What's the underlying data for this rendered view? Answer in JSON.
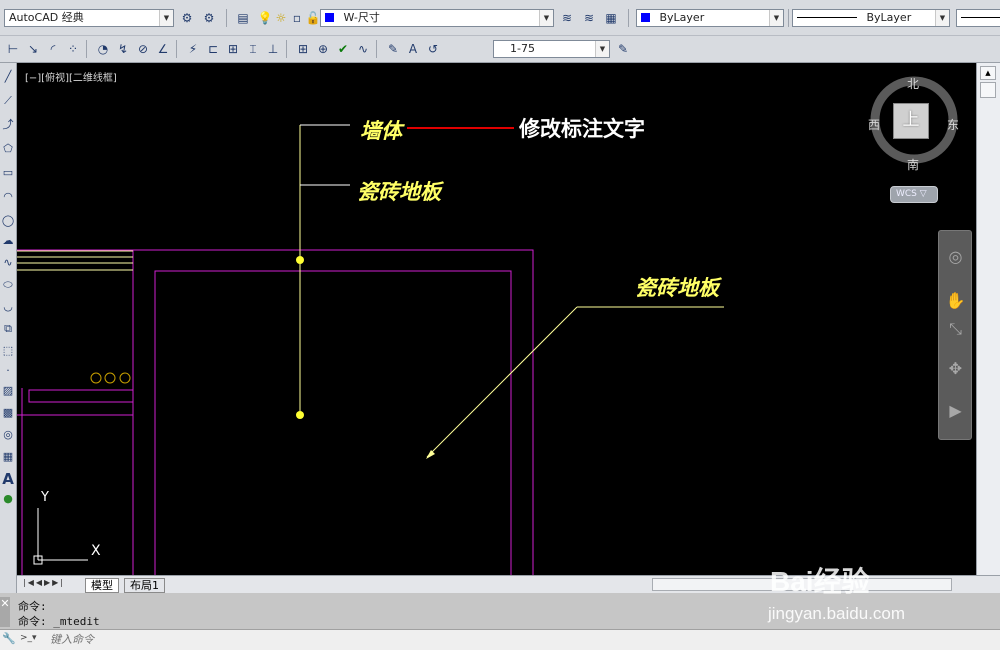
{
  "toolbar1": {
    "workspace": "AutoCAD 经典",
    "layer": "W-尺寸",
    "color": "ByLayer",
    "linetype": "ByLayer"
  },
  "toolbar2": {
    "dimstyle": "1-75"
  },
  "viewport": {
    "title": "[−][俯视][二维线框]"
  },
  "annotations": {
    "wall": "墙体",
    "tile1": "瓷砖地板",
    "tile2": "瓷砖地板",
    "callout": "修改标注文字"
  },
  "viewcube": {
    "north": "北",
    "south": "南",
    "west": "西",
    "east": "东",
    "top": "上",
    "wcs": "WCS ▽"
  },
  "ucs": {
    "x": "X",
    "y": "Y"
  },
  "tabs": {
    "model": "模型",
    "layout": "布局1"
  },
  "command": {
    "line1": "命令:",
    "line2": "命令: _mtedit",
    "placeholder": "键入命令"
  },
  "watermark": {
    "brand": "Bai经验",
    "url": "jingyan.baidu.com"
  },
  "colors": {
    "canvas": "#000000",
    "magenta": "#d020d0",
    "yellow": "#ffff66",
    "red": "#e00000"
  }
}
